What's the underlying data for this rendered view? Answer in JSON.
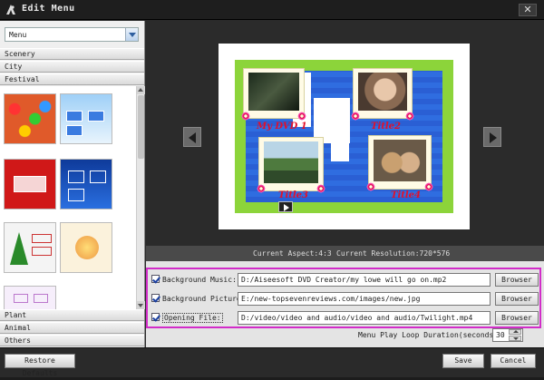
{
  "window": {
    "title": "Edit Menu",
    "close_symbol": "✕"
  },
  "sidebar": {
    "dropdown_value": "Menu",
    "categories_top": [
      "Scenery",
      "City",
      "Festival"
    ],
    "categories_bottom": [
      "Plant",
      "Animal",
      "Others"
    ]
  },
  "preview": {
    "titles": [
      "My DVD 1",
      "Title2",
      "Title3",
      "Title4"
    ],
    "aspect": "Current Aspect:4:3",
    "resolution": "Current Resolution:720*576"
  },
  "settings": {
    "rows": [
      {
        "label": "Background Music:",
        "value": "D:/Aiseesoft DVD Creator/my lowe will go on.mp2",
        "button": "Browser"
      },
      {
        "label": "Background Picture:",
        "value": "E:/new-topsevenreviews.com/images/new.jpg",
        "button": "Browser"
      },
      {
        "label": "Opening File:",
        "value": "D:/video/video and audio/video and audio/Twilight.mp4",
        "button": "Browser"
      }
    ],
    "loop_label": "Menu Play Loop Duration(seconds):",
    "loop_value": "30"
  },
  "footer": {
    "restore": "Restore Defaults",
    "save": "Save",
    "cancel": "Cancel"
  },
  "colors": {
    "highlight_border": "#d22cc9",
    "title_text": "#e2102a",
    "menu_green": "#8cd43a",
    "menu_blue": "#2f66d8"
  }
}
